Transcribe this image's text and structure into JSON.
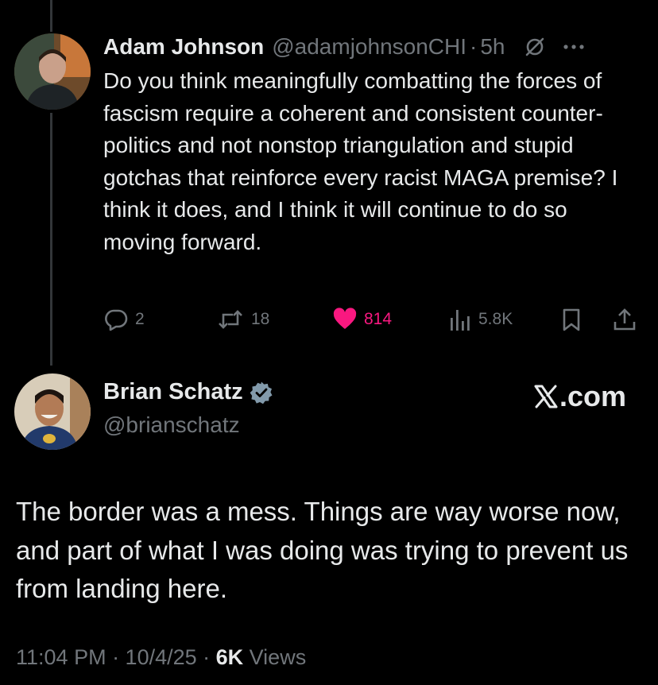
{
  "reply": {
    "display_name": "Adam Johnson",
    "handle": "@adamjohnsonCHI",
    "separator": "·",
    "time": "5h",
    "text": "Do you think meaningfully combatting the forces of fascism require a coherent and consistent counter-politics and not nonstop triangulation and stupid gotchas that reinforce every racist MAGA premise? I think it does, and I think it will continue to do so moving forward.",
    "actions": {
      "replies": "2",
      "reposts": "18",
      "likes": "814",
      "views": "5.8K"
    }
  },
  "main": {
    "display_name": "Brian Schatz",
    "handle": "@brianschatz",
    "brand": "X.com",
    "text": "The border was a mess. Things are way worse now, and part of what I was doing was trying to prevent us from landing here.",
    "timestamp": "11:04 PM · 10/4/25 · ",
    "views_count": "6K",
    "views_label": " Views"
  },
  "colors": {
    "background": "#000000",
    "text": "#e7e9ea",
    "muted": "#71767b",
    "like": "#f91880",
    "verified": "#829aab"
  },
  "icons": {
    "reply_icon": "comment-bubble-icon",
    "repost_icon": "repost-icon",
    "like_icon": "heart-icon",
    "views_icon": "bar-chart-icon",
    "bookmark_icon": "bookmark-icon",
    "share_icon": "share-icon",
    "grok_icon": "slash-circle-icon",
    "more_icon": "more-dots-icon",
    "verified_icon": "verified-badge-icon"
  }
}
